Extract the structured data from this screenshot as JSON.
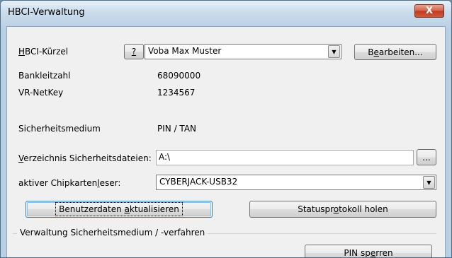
{
  "window": {
    "title": "HBCI-Verwaltung",
    "close_label": "X"
  },
  "hbci": {
    "kuerzel_label": "HBCI-Kürzel",
    "help_label": "?",
    "selected": "Voba Max Muster",
    "edit_button": "Bearbeiten..."
  },
  "info": {
    "blz_label": "Bankleitzahl",
    "blz_value": "68090000",
    "netkey_label": "VR-NetKey",
    "netkey_value": "1234567",
    "medium_label": "Sicherheitsmedium",
    "medium_value": "PIN / TAN"
  },
  "paths": {
    "dir_label": "Verzeichnis Sicherheitsdateien:",
    "dir_value": "A:\\",
    "browse_label": "...",
    "reader_label": "aktiver Chipkartenleser:",
    "reader_value": "CYBERJACK-USB32"
  },
  "actions": {
    "update_button": "Benutzerdaten aktualisieren",
    "status_button": "Statusprotokoll holen"
  },
  "group": {
    "title": "Verwaltung Sicherheitsmedium / -verfahren",
    "pin_lock_button": "PIN sperren"
  }
}
